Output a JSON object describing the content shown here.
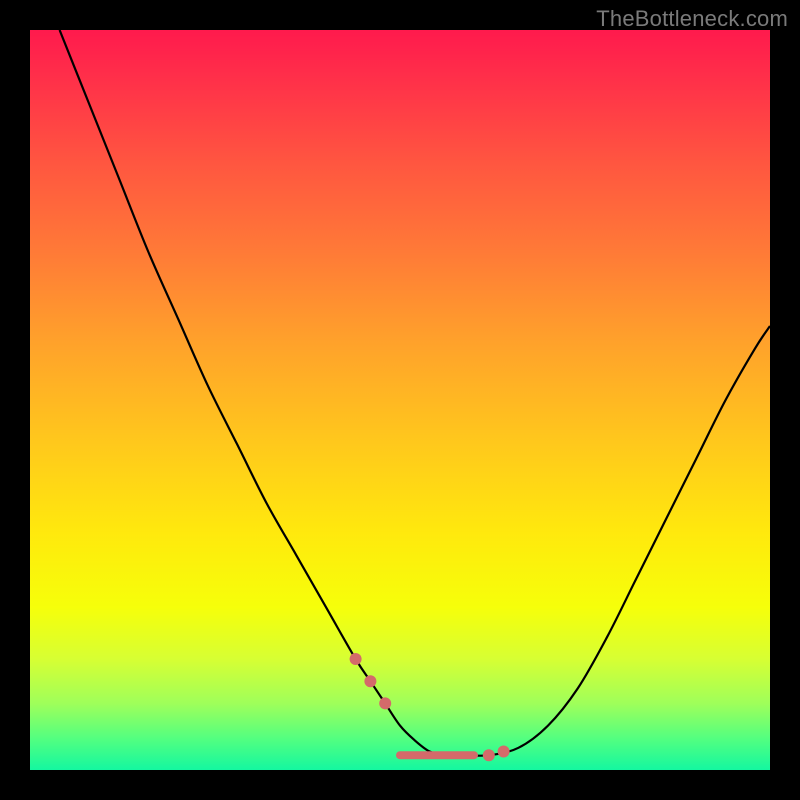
{
  "watermark": "TheBottleneck.com",
  "chart_data": {
    "type": "line",
    "title": "",
    "xlabel": "",
    "ylabel": "",
    "xlim": [
      0,
      100
    ],
    "ylim": [
      0,
      100
    ],
    "grid": false,
    "series": [
      {
        "name": "curve",
        "x": [
          4,
          8,
          12,
          16,
          20,
          24,
          28,
          32,
          36,
          40,
          44,
          46,
          48,
          50,
          52,
          54,
          56,
          58,
          62,
          66,
          70,
          74,
          78,
          82,
          86,
          90,
          94,
          98,
          100
        ],
        "y": [
          100,
          90,
          80,
          70,
          61,
          52,
          44,
          36,
          29,
          22,
          15,
          12,
          9,
          6,
          4,
          2.5,
          2,
          2,
          2,
          3,
          6,
          11,
          18,
          26,
          34,
          42,
          50,
          57,
          60
        ]
      }
    ],
    "annotations": {
      "markers": [
        {
          "x": 44,
          "y": 15
        },
        {
          "x": 46,
          "y": 12
        },
        {
          "x": 48,
          "y": 9
        },
        {
          "x": 62,
          "y": 2
        },
        {
          "x": 64,
          "y": 2.5
        }
      ],
      "trough_bar": {
        "x_start": 50,
        "x_end": 60,
        "y": 2
      }
    },
    "background_gradient": {
      "top": "#ff1a4d",
      "mid": "#ffe90d",
      "bottom": "#14f7a0"
    }
  }
}
